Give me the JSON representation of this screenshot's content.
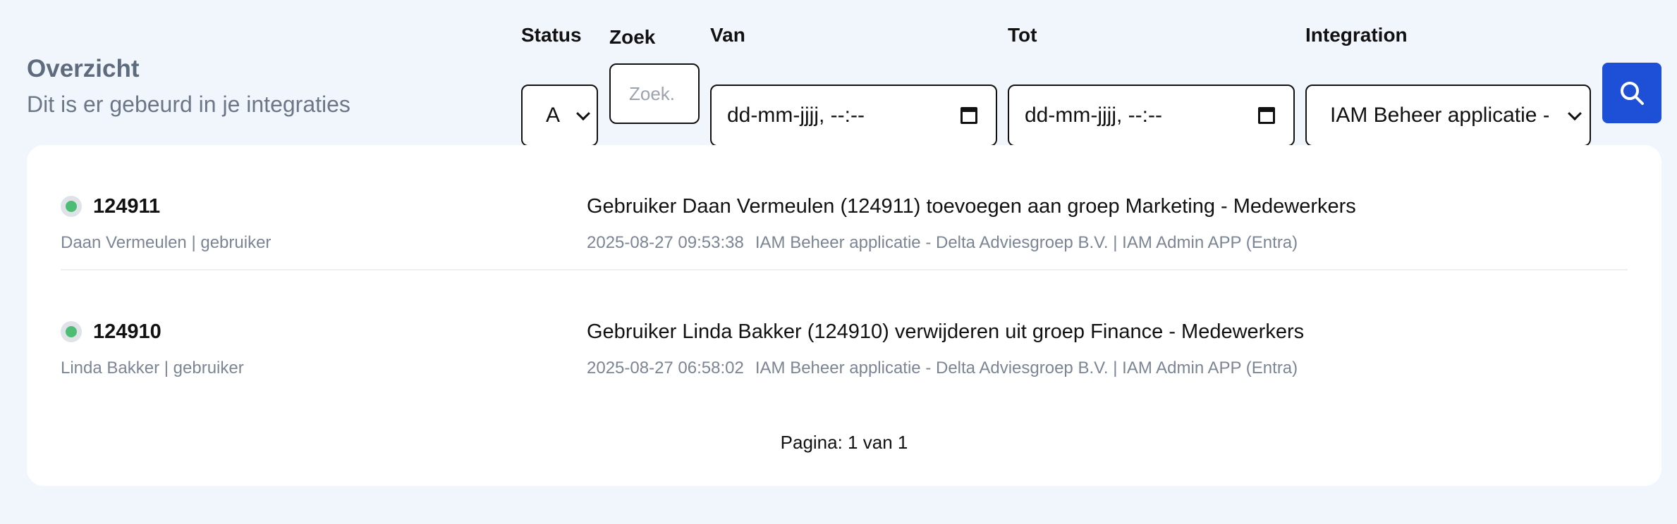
{
  "header": {
    "title": "Overzicht",
    "subtitle": "Dit is er gebeurd in je integraties"
  },
  "filters": {
    "status": {
      "label": "Status",
      "value": "A"
    },
    "search": {
      "label": "Zoek",
      "placeholder": "Zoek."
    },
    "from": {
      "label": "Van",
      "value": "dd-mm-jjjj, --:--"
    },
    "to": {
      "label": "Tot",
      "value": "dd-mm-jjjj, --:--"
    },
    "integration": {
      "label": "Integration",
      "value": "IAM Beheer applicatie - Delta Adviesgroep B.V."
    },
    "search_button_icon": "search-icon"
  },
  "colors": {
    "accent": "#1d4fd7",
    "status_ok": "#4dbd74",
    "background": "#f1f6fd"
  },
  "events": [
    {
      "id": "124911",
      "user": "Daan Vermeulen | gebruiker",
      "description": "Gebruiker Daan Vermeulen (124911) toevoegen aan groep Marketing - Medewerkers",
      "timestamp": "2025-08-27 09:53:38",
      "source": "IAM Beheer applicatie - Delta Adviesgroep B.V. | IAM Admin APP (Entra)",
      "status": "success"
    },
    {
      "id": "124910",
      "user": "Linda Bakker | gebruiker",
      "description": "Gebruiker Linda Bakker (124910) verwijderen uit groep Finance - Medewerkers",
      "timestamp": "2025-08-27 06:58:02",
      "source": "IAM Beheer applicatie - Delta Adviesgroep B.V. | IAM Admin APP (Entra)",
      "status": "success"
    }
  ],
  "pagination": {
    "text": "Pagina: 1 van 1"
  }
}
